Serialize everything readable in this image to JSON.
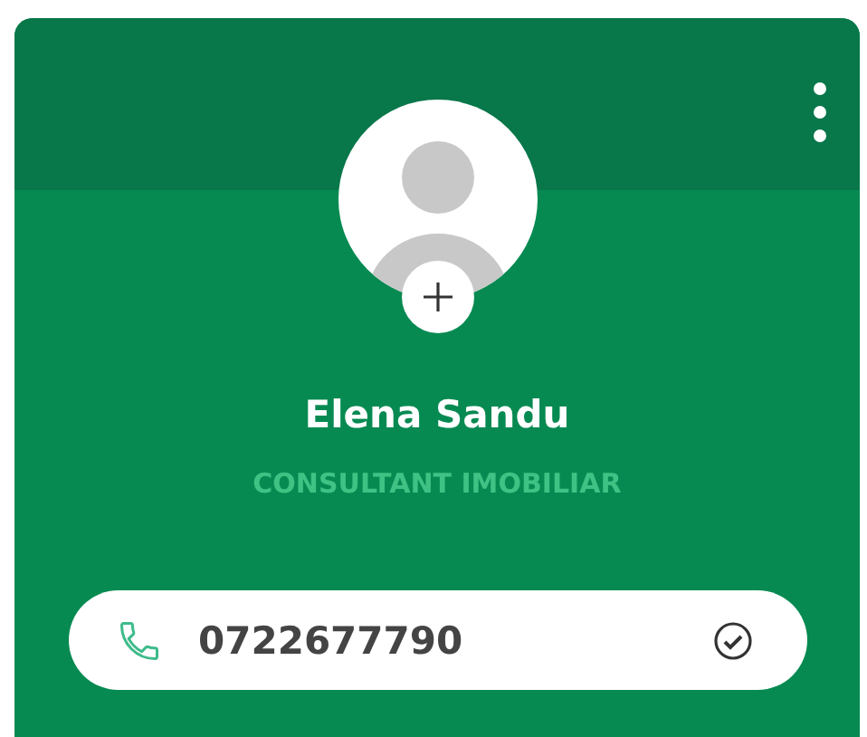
{
  "profile": {
    "name": "Elena Sandu",
    "role": "CONSULTANT IMOBILIAR"
  },
  "phone": {
    "value": "0722677790",
    "verified": true
  }
}
